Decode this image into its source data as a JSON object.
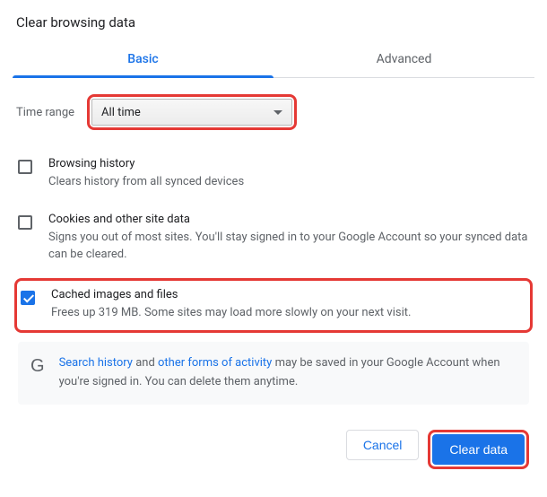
{
  "title": "Clear browsing data",
  "tabs": {
    "basic": "Basic",
    "advanced": "Advanced"
  },
  "time": {
    "label": "Time range",
    "value": "All time"
  },
  "options": [
    {
      "title": "Browsing history",
      "desc": "Clears history from all synced devices",
      "checked": false
    },
    {
      "title": "Cookies and other site data",
      "desc": "Signs you out of most sites. You'll stay signed in to your Google Account so your synced data can be cleared.",
      "checked": false
    },
    {
      "title": "Cached images and files",
      "desc": "Frees up 319 MB. Some sites may load more slowly on your next visit.",
      "checked": true
    }
  ],
  "info": {
    "link1": "Search history",
    "mid": " and ",
    "link2": "other forms of activity",
    "rest": " may be saved in your Google Account when you're signed in. You can delete them anytime."
  },
  "buttons": {
    "cancel": "Cancel",
    "clear": "Clear data"
  }
}
